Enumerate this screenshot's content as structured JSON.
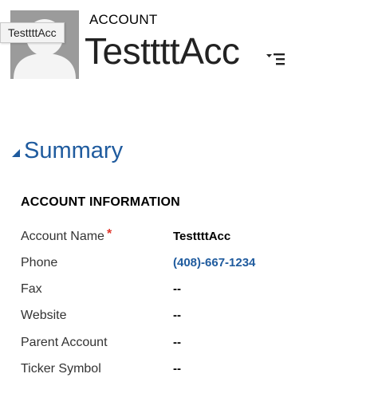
{
  "header": {
    "tooltip": "TesttttAcc",
    "entity_type": "ACCOUNT",
    "entity_name": "TesttttAcc",
    "menu_icon": "list-menu-icon",
    "avatar_icon": "default-person-icon"
  },
  "section": {
    "title": "Summary",
    "caret_icon": "expanded-caret-icon"
  },
  "group": {
    "title": "ACCOUNT INFORMATION"
  },
  "fields": [
    {
      "label": "Account Name",
      "required_mark": "*",
      "value": "TesttttAcc"
    },
    {
      "label": "Phone",
      "value": "(408)-667-1234"
    },
    {
      "label": "Fax",
      "value": "--"
    },
    {
      "label": "Website",
      "value": "--"
    },
    {
      "label": "Parent Account",
      "value": "--"
    },
    {
      "label": "Ticker Symbol",
      "value": "--"
    }
  ],
  "colors": {
    "link": "#1f5b9e",
    "required": "#e0362b",
    "avatar_bg": "#9b9b9b"
  }
}
